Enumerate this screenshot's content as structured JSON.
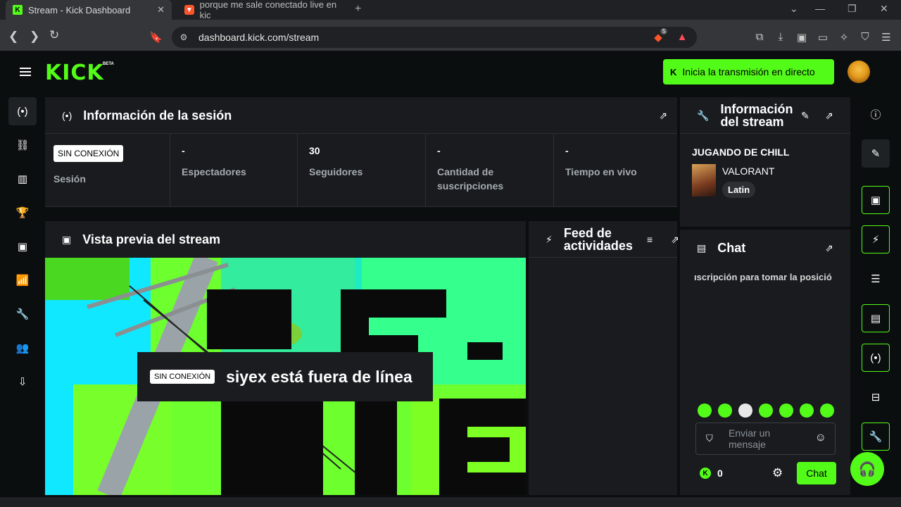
{
  "browser": {
    "tabs": [
      {
        "title": "Stream - Kick Dashboard",
        "favicon": "K"
      },
      {
        "title": "porque me sale conectado live en kic",
        "favicon": "brave-icon"
      }
    ],
    "url": "dashboard.kick.com/stream",
    "extension_badge": "5"
  },
  "header": {
    "logo": "KICK",
    "logo_badge": "BETA",
    "go_live_label": "Inicia la transmisión en directo",
    "go_live_icon": "K"
  },
  "session": {
    "title": "Información de la sesión",
    "status_badge": "SIN CONEXIÓN",
    "stats": [
      {
        "value": "",
        "label": "Sesión"
      },
      {
        "value": "-",
        "label": "Espectadores"
      },
      {
        "value": "30",
        "label": "Seguidores"
      },
      {
        "value": "-",
        "label": "Cantidad de suscripciones"
      },
      {
        "value": "-",
        "label": "Tiempo en vivo"
      }
    ]
  },
  "stream_info": {
    "title": "Información del stream",
    "stream_title": "JUGANDO DE CHILL",
    "category": "VALORANT",
    "tag": "Latin"
  },
  "preview": {
    "title": "Vista previa del stream",
    "offline_badge": "SIN CONEXIÓN",
    "offline_message": "siyex está fuera de línea",
    "offline_art_text": "OFF-LINE"
  },
  "activity": {
    "title": "Feed de actividades"
  },
  "chat": {
    "title": "Chat",
    "pinned_message": "ıscripción para tomar la posició",
    "input_placeholder": "Enviar un mensaje",
    "points": "0",
    "send_label": "Chat"
  },
  "colors": {
    "accent": "#53fc18",
    "panel": "#191b1f",
    "background": "#0b0e0f"
  }
}
